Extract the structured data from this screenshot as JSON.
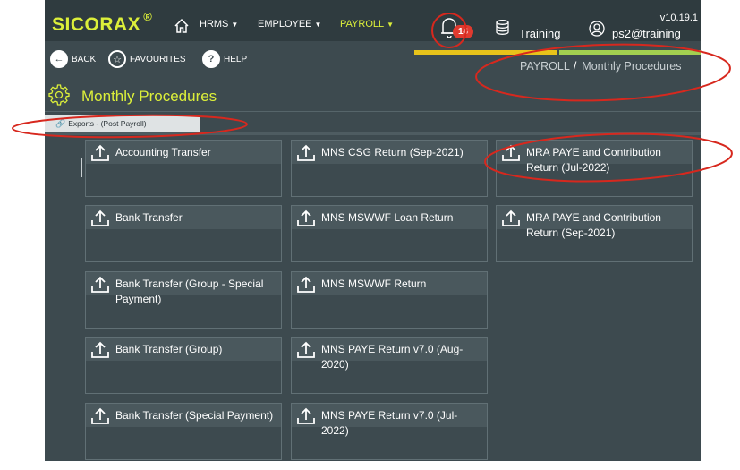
{
  "header": {
    "brand": "SICORAX",
    "brand_mark": "®",
    "nav": [
      {
        "label": "HRMS",
        "active": false
      },
      {
        "label": "EMPLOYEE",
        "active": false
      },
      {
        "label": "PAYROLL",
        "active": true
      }
    ],
    "notifications_count": "14",
    "database_label": "Training",
    "user_label": "ps2@training",
    "version": "v10.19.1",
    "icons": [
      "home-icon",
      "bell-icon",
      "database-icon",
      "user-icon"
    ]
  },
  "toolbar": {
    "back_label": "BACK",
    "favourites_label": "FAVOURITES",
    "help_label": "HELP"
  },
  "breadcrumb": {
    "parent": "PAYROLL",
    "separator": "/",
    "current": "Monthly Procedures"
  },
  "page": {
    "title": "Monthly Procedures",
    "section_tab": "Exports - (Post Payroll)"
  },
  "tiles": {
    "col1": [
      "Accounting Transfer",
      "Bank Transfer",
      "Bank Transfer (Group - Special Payment)",
      "Bank Transfer (Group)",
      "Bank Transfer (Special Payment)"
    ],
    "col2": [
      "MNS CSG Return (Sep-2021)",
      "MNS MSWWF Loan Return",
      "MNS MSWWF Return",
      "MNS PAYE Return v7.0 (Aug-2020)",
      "MNS PAYE Return v7.0 (Jul-2022)"
    ],
    "col3": [
      "MRA PAYE and Contribution Return (Jul-2022)",
      "MRA PAYE and Contribution Return (Sep-2021)"
    ]
  },
  "colors": {
    "accent": "#dcef3a",
    "background": "#3d4a4f",
    "topbar": "#2f3b3f",
    "badge": "#e03a2f",
    "progress_yellow": "#e8c31a",
    "progress_green": "#a3d050"
  }
}
